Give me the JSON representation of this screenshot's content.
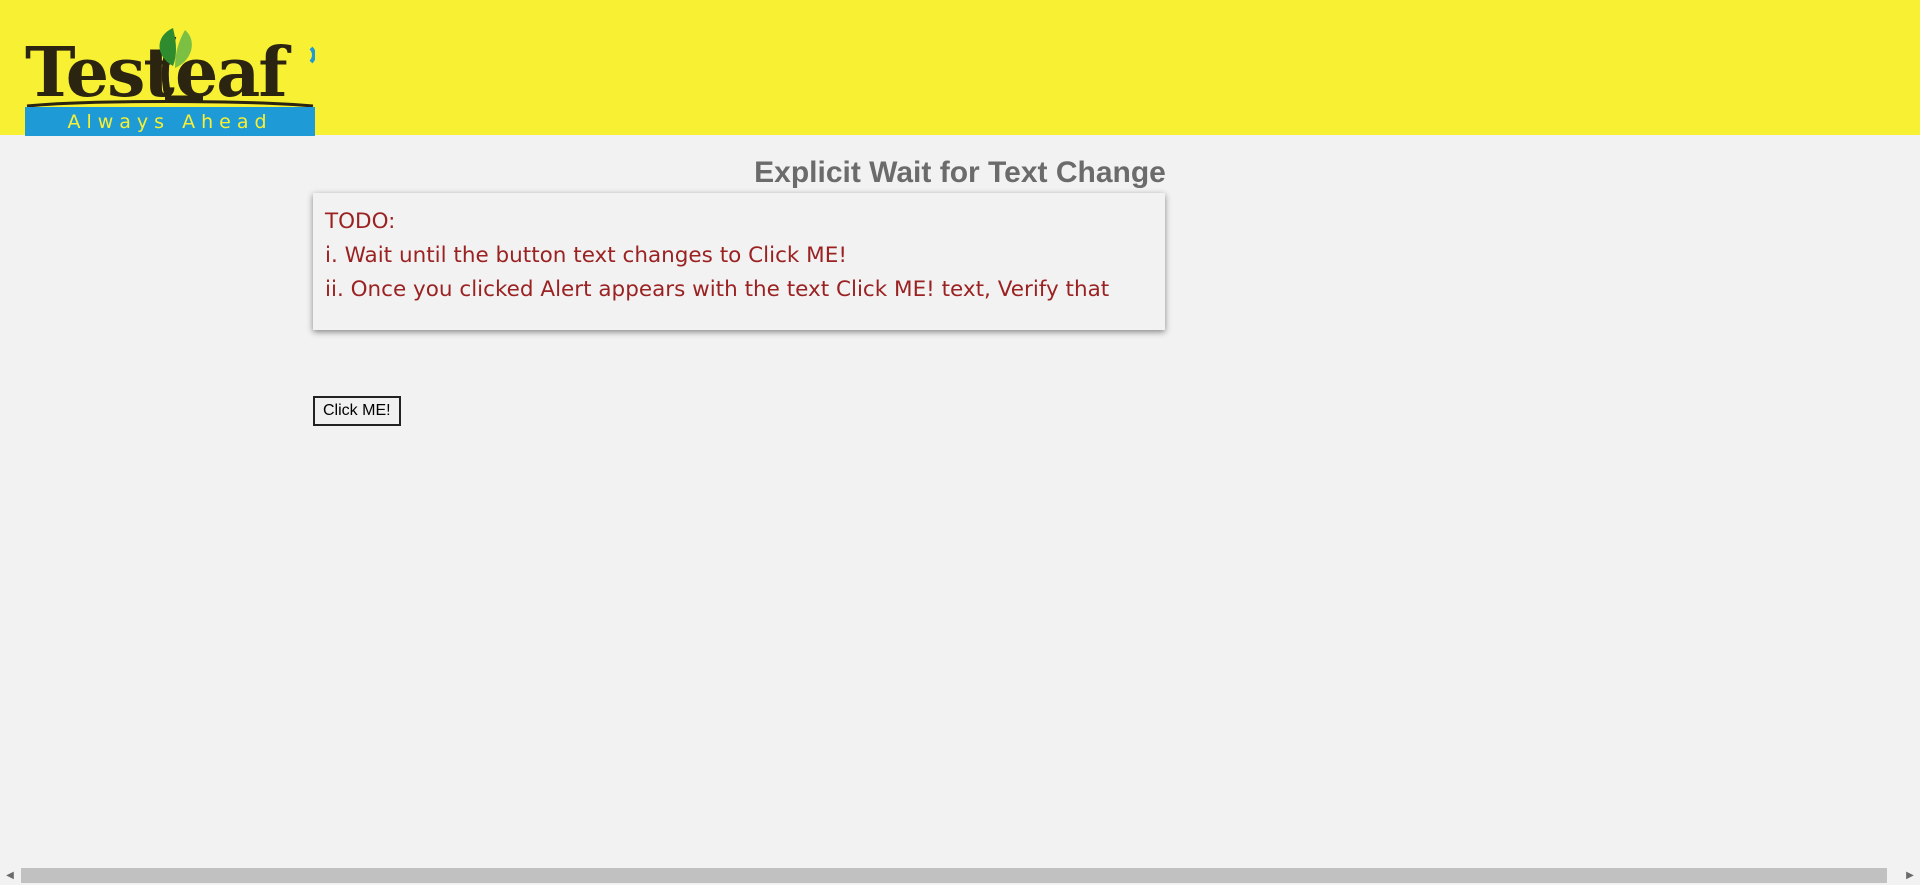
{
  "header": {
    "logo": {
      "brand_text": "TestLeaf",
      "tagline": "Always Ahead",
      "colors": {
        "letters": "#2b2411",
        "tagline_bg": "#1e9ad6",
        "tagline_text": "#f8f032",
        "leaf": "#46a53a"
      }
    },
    "background_color": "#f8f032"
  },
  "main": {
    "title": "Explicit Wait for Text Change",
    "todo": {
      "lines": [
        "TODO:",
        "i. Wait until the button text changes to Click ME!",
        "ii. Once you clicked Alert appears with the text Click ME! text, Verify that"
      ],
      "text_color": "#9b2222"
    },
    "button": {
      "label": "Click ME!"
    }
  },
  "scrollbar": {
    "left_arrow_icon": "triangle-left-icon",
    "right_arrow_icon": "triangle-right-icon"
  }
}
